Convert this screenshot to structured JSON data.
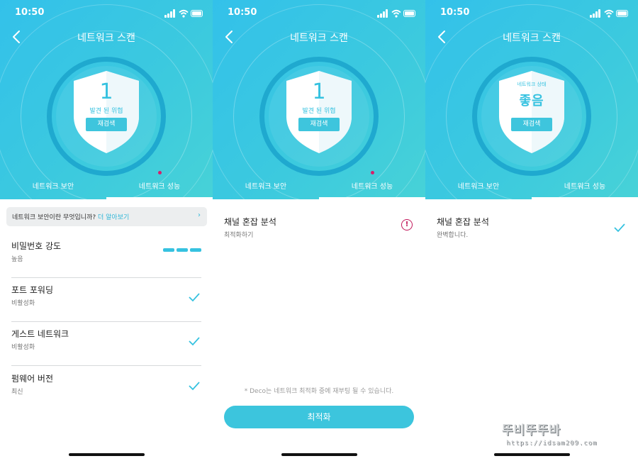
{
  "status_bar": {
    "time": "10:50"
  },
  "header": {
    "title": "네트워크 스캔"
  },
  "tabs": {
    "security": "네트워크 보안",
    "performance": "네트워크 성능"
  },
  "screens": [
    {
      "shield": {
        "count": "1",
        "label": "발견 된 위협",
        "rescan": "재검색"
      },
      "info_bar": {
        "text": "네트워크 보안이란 무엇입니까? ",
        "link": "더 알아보기",
        "chevron": "›"
      },
      "items": [
        {
          "title": "비밀번호 강도",
          "subtitle": "높음",
          "indicator": "strength-bars"
        },
        {
          "title": "포트 포워딩",
          "subtitle": "비활성화",
          "indicator": "check-icon"
        },
        {
          "title": "게스트 네트워크",
          "subtitle": "비활성화",
          "indicator": "check-icon"
        },
        {
          "title": "펌웨어 버전",
          "subtitle": "최신",
          "indicator": "check-icon"
        }
      ]
    },
    {
      "shield": {
        "count": "1",
        "label": "발견 된 위협",
        "rescan": "재검색"
      },
      "items": [
        {
          "title": "채널 혼잡 분석",
          "subtitle": "최적화하기",
          "indicator": "warning-icon"
        }
      ],
      "note": "* Deco는 네트워크 최적화 중에 재부팅 될 수 있습니다.",
      "button": "최적화"
    },
    {
      "shield": {
        "status_label": "네트워크 상태",
        "status": "좋음",
        "rescan": "재검색"
      },
      "items": [
        {
          "title": "채널 혼잡 분석",
          "subtitle": "완벽합니다.",
          "indicator": "check-icon"
        }
      ]
    }
  ],
  "watermark": {
    "title": "뚜비뚜뚜바",
    "url": "https://idsam209.com"
  },
  "colors": {
    "accent": "#36c2e0",
    "header_gradient_start": "#33c1ea",
    "header_gradient_end": "#47d2d7",
    "alert_dot": "#d61f6b",
    "warning": "#c2185b",
    "divider": "#d7d9db"
  }
}
